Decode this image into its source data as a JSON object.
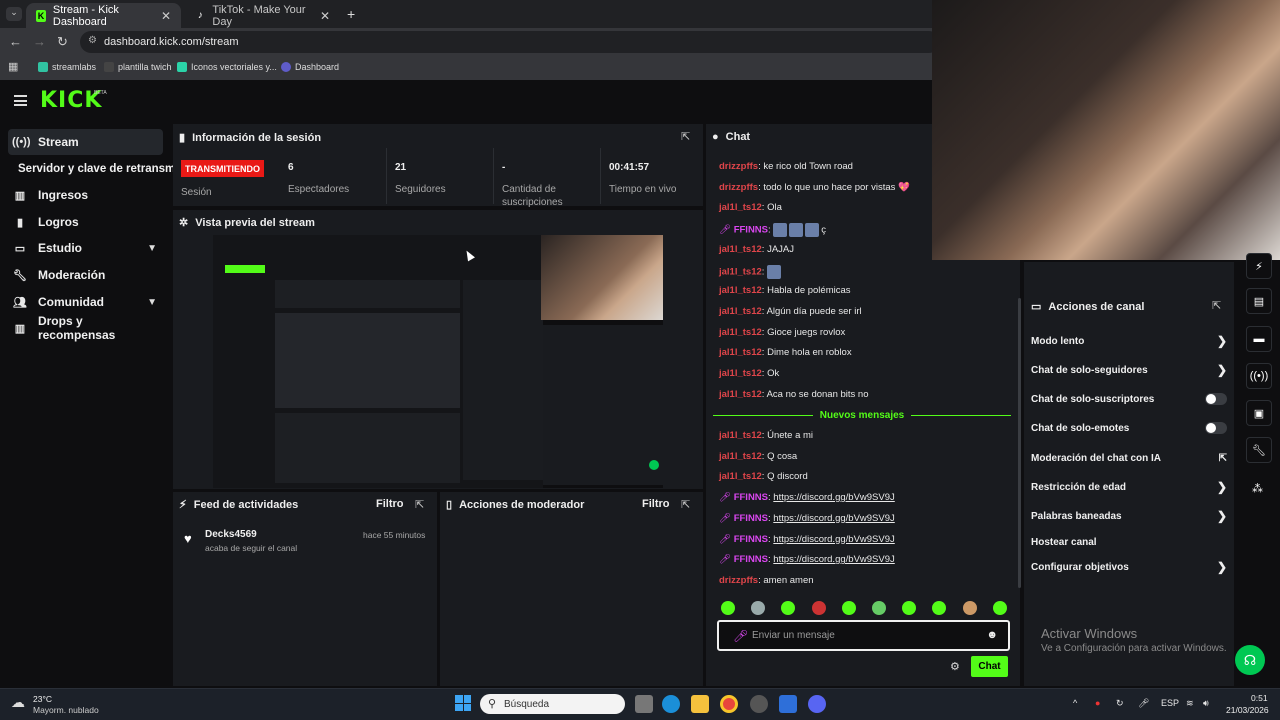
{
  "browser": {
    "tabs": [
      {
        "title": "Stream - Kick Dashboard",
        "icon": "kick-favicon"
      },
      {
        "title": "TikTok - Make Your Day",
        "icon": "tiktok-favicon"
      }
    ],
    "new_tab": "+",
    "url": "dashboard.kick.com/stream",
    "bookmarks": [
      "streamlabs",
      "plantilla twich",
      "Iconos vectoriales y...",
      "Dashboard"
    ]
  },
  "header": {
    "logo": "KICK",
    "beta": "BETA"
  },
  "sidebar": {
    "items": [
      {
        "label": "Stream",
        "icon": "broadcast-icon"
      },
      {
        "label": "Servidor y clave de retransm",
        "icon": ""
      },
      {
        "label": "Ingresos",
        "icon": "bank-icon"
      },
      {
        "label": "Logros",
        "icon": "trophy-icon"
      },
      {
        "label": "Estudio",
        "icon": "studio-icon"
      },
      {
        "label": "Moderación",
        "icon": "wrench-icon"
      },
      {
        "label": "Comunidad",
        "icon": "community-icon"
      },
      {
        "label": "Drops y recompensas",
        "icon": "drops-icon"
      }
    ]
  },
  "session": {
    "title": "Información de la sesión",
    "status_badge": "TRANSMITIENDO",
    "status_label": "Sesión",
    "stats": [
      {
        "value": "6",
        "label": "Espectadores"
      },
      {
        "value": "21",
        "label": "Seguidores"
      },
      {
        "value": "-",
        "label": "Cantidad de suscripciones"
      },
      {
        "value": "00:41:57",
        "label": "Tiempo en vivo"
      }
    ]
  },
  "preview": {
    "title": "Vista previa del stream"
  },
  "activity": {
    "title": "Feed de actividades",
    "filter": "Filtro",
    "items": [
      {
        "user": "Decks4569",
        "action": "acaba de seguir el canal",
        "time": "hace 55 minutos"
      }
    ]
  },
  "modactions": {
    "title": "Acciones de moderador",
    "filter": "Filtro"
  },
  "chat": {
    "title": "Chat",
    "messages": [
      {
        "user": "drizzpffs",
        "color": "#e0454a",
        "text": "ke rico old Town road"
      },
      {
        "user": "drizzpffs",
        "color": "#e0454a",
        "text": "todo lo que uno hace por vistas 💖"
      },
      {
        "user": "jal1l_ts12",
        "color": "#e0454a",
        "text": "Ola"
      },
      {
        "user": "FFINNS",
        "color": "#d946ef",
        "text": "ç",
        "emotes": 3,
        "badge": true
      },
      {
        "user": "jal1l_ts12",
        "color": "#e0454a",
        "text": "JAJAJ"
      },
      {
        "user": "jal1l_ts12",
        "color": "#e0454a",
        "text": "",
        "emotes": 1
      },
      {
        "user": "jal1l_ts12",
        "color": "#e0454a",
        "text": "Habla de polémicas"
      },
      {
        "user": "jal1l_ts12",
        "color": "#e0454a",
        "text": "Algún día puede ser irl"
      },
      {
        "user": "jal1l_ts12",
        "color": "#e0454a",
        "text": "Gioce juegs rovlox"
      },
      {
        "user": "jal1l_ts12",
        "color": "#e0454a",
        "text": "Dime hola en roblox"
      },
      {
        "user": "jal1l_ts12",
        "color": "#e0454a",
        "text": "Ok"
      },
      {
        "user": "jal1l_ts12",
        "color": "#e0454a",
        "text": "Aca no se donan bits no"
      }
    ],
    "new_messages_label": "Nuevos mensajes",
    "new_messages": [
      {
        "user": "jal1l_ts12",
        "color": "#e0454a",
        "text": "Únete a mi"
      },
      {
        "user": "jal1l_ts12",
        "color": "#e0454a",
        "text": "Q cosa"
      },
      {
        "user": "jal1l_ts12",
        "color": "#e0454a",
        "text": "Q discord"
      },
      {
        "user": "FFINNS",
        "color": "#d946ef",
        "link": "https://discord.gg/bVw9SV9J",
        "badge": true
      },
      {
        "user": "FFINNS",
        "color": "#d946ef",
        "link": "https://discord.gg/bVw9SV9J",
        "badge": true
      },
      {
        "user": "FFINNS",
        "color": "#d946ef",
        "link": "https://discord.gg/bVw9SV9J",
        "badge": true
      },
      {
        "user": "FFINNS",
        "color": "#d946ef",
        "link": "https://discord.gg/bVw9SV9J",
        "badge": true
      },
      {
        "user": "drizzpffs",
        "color": "#e0454a",
        "text": "amen amen"
      }
    ],
    "input_placeholder": "Enviar un mensaje",
    "send_label": "Chat"
  },
  "channel_actions": {
    "title": "Acciones de canal",
    "items": [
      {
        "label": "Modo lento",
        "control": "chevron"
      },
      {
        "label": "Chat de solo-seguidores",
        "control": "chevron"
      },
      {
        "label": "Chat de solo-suscriptores",
        "control": "toggle"
      },
      {
        "label": "Chat de solo-emotes",
        "control": "toggle"
      },
      {
        "label": "Moderación del chat con IA",
        "control": "external"
      },
      {
        "label": "Restricción de edad",
        "control": "chevron"
      },
      {
        "label": "Palabras baneadas",
        "control": "chevron"
      },
      {
        "label": "Hostear canal",
        "control": "none"
      },
      {
        "label": "Configurar objetivos",
        "control": "chevron"
      }
    ]
  },
  "watermark": {
    "line1": "Activar Windows",
    "line2": "Ve a Configuración para activar Windows."
  },
  "taskbar": {
    "weather_temp": "23°C",
    "weather_desc": "Mayorm. nublado",
    "search_placeholder": "Búsqueda",
    "lang": "ESP",
    "time": "0:51",
    "date": "21/03/2026"
  },
  "colors": {
    "accent": "#53fc18",
    "live": "#e91916"
  }
}
